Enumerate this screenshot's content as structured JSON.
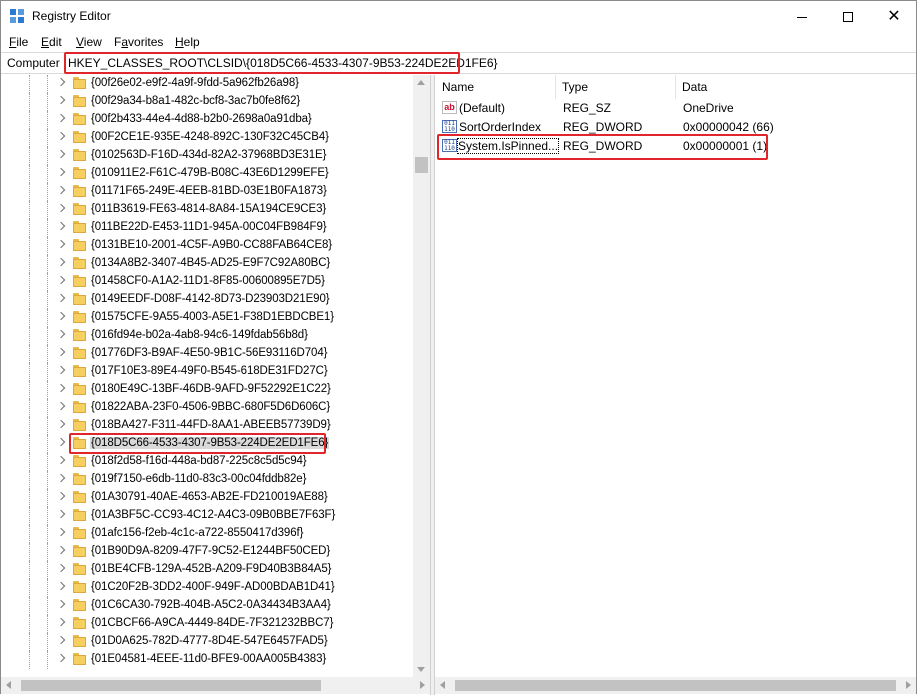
{
  "window": {
    "title": "Registry Editor",
    "icon": "registry-editor-icon"
  },
  "menu": [
    "File",
    "Edit",
    "View",
    "Favorites",
    "Help"
  ],
  "menu_accel": [
    "F",
    "E",
    "V",
    "a",
    "H"
  ],
  "address": {
    "label": "Computer",
    "path": "HKEY_CLASSES_ROOT\\CLSID\\{018D5C66-4533-4307-9B53-224DE2ED1FE6}"
  },
  "tree": {
    "items": [
      "{00f26e02-e9f2-4a9f-9fdd-5a962fb26a98}",
      "{00f29a34-b8a1-482c-bcf8-3ac7b0fe8f62}",
      "{00f2b433-44e4-4d88-b2b0-2698a0a91dba}",
      "{00F2CE1E-935E-4248-892C-130F32C45CB4}",
      "{0102563D-F16D-434d-82A2-37968BD3E31E}",
      "{010911E2-F61C-479B-B08C-43E6D1299EFE}",
      "{01171F65-249E-4EEB-81BD-03E1B0FA1873}",
      "{011B3619-FE63-4814-8A84-15A194CE9CE3}",
      "{011BE22D-E453-11D1-945A-00C04FB984F9}",
      "{0131BE10-2001-4C5F-A9B0-CC88FAB64CE8}",
      "{0134A8B2-3407-4B45-AD25-E9F7C92A80BC}",
      "{01458CF0-A1A2-11D1-8F85-00600895E7D5}",
      "{0149EEDF-D08F-4142-8D73-D23903D21E90}",
      "{01575CFE-9A55-4003-A5E1-F38D1EBDCBE1}",
      "{016fd94e-b02a-4ab8-94c6-149fdab56b8d}",
      "{01776DF3-B9AF-4E50-9B1C-56E93116D704}",
      "{017F10E3-89E4-49F0-B545-618DE31FD27C}",
      "{0180E49C-13BF-46DB-9AFD-9F52292E1C22}",
      "{01822ABA-23F0-4506-9BBC-680F5D6D606C}",
      "{018BA427-F311-44FD-8AA1-ABEEB57739D9}",
      "{018D5C66-4533-4307-9B53-224DE2ED1FE6}",
      "{018f2d58-f16d-448a-bd87-225c8c5d5c94}",
      "{019f7150-e6db-11d0-83c3-00c04fddb82e}",
      "{01A30791-40AE-4653-AB2E-FD210019AE88}",
      "{01A3BF5C-CC93-4C12-A4C3-09B0BBE7F63F}",
      "{01afc156-f2eb-4c1c-a722-8550417d396f}",
      "{01B90D9A-8209-47F7-9C52-E1244BF50CED}",
      "{01BE4CFB-129A-452B-A209-F9D40B3B84A5}",
      "{01C20F2B-3DD2-400F-949F-AD00BDAB1D41}",
      "{01C6CA30-792B-404B-A5C2-0A34434B3AA4}",
      "{01CBCF66-A9CA-4449-84DE-7F321232BBC7}",
      "{01D0A625-782D-4777-8D4E-547E6457FAD5}",
      "{01E04581-4EEE-11d0-BFE9-00AA005B4383}"
    ],
    "selected_index": 20
  },
  "values": {
    "headers": {
      "name": "Name",
      "type": "Type",
      "data": "Data"
    },
    "rows": [
      {
        "icon": "string-value-icon",
        "name": "(Default)",
        "type": "REG_SZ",
        "data": "OneDrive"
      },
      {
        "icon": "binary-value-icon",
        "name": "SortOrderIndex",
        "type": "REG_DWORD",
        "data": "0x00000042 (66)"
      },
      {
        "icon": "binary-value-icon",
        "name": "System.IsPinned...",
        "type": "REG_DWORD",
        "data": "0x00000001 (1)"
      }
    ]
  },
  "colors": {
    "highlight": "#e0262b",
    "folder": "#f6cf60",
    "selection": "#d9d9d9",
    "accent": "#2b7bd4"
  }
}
